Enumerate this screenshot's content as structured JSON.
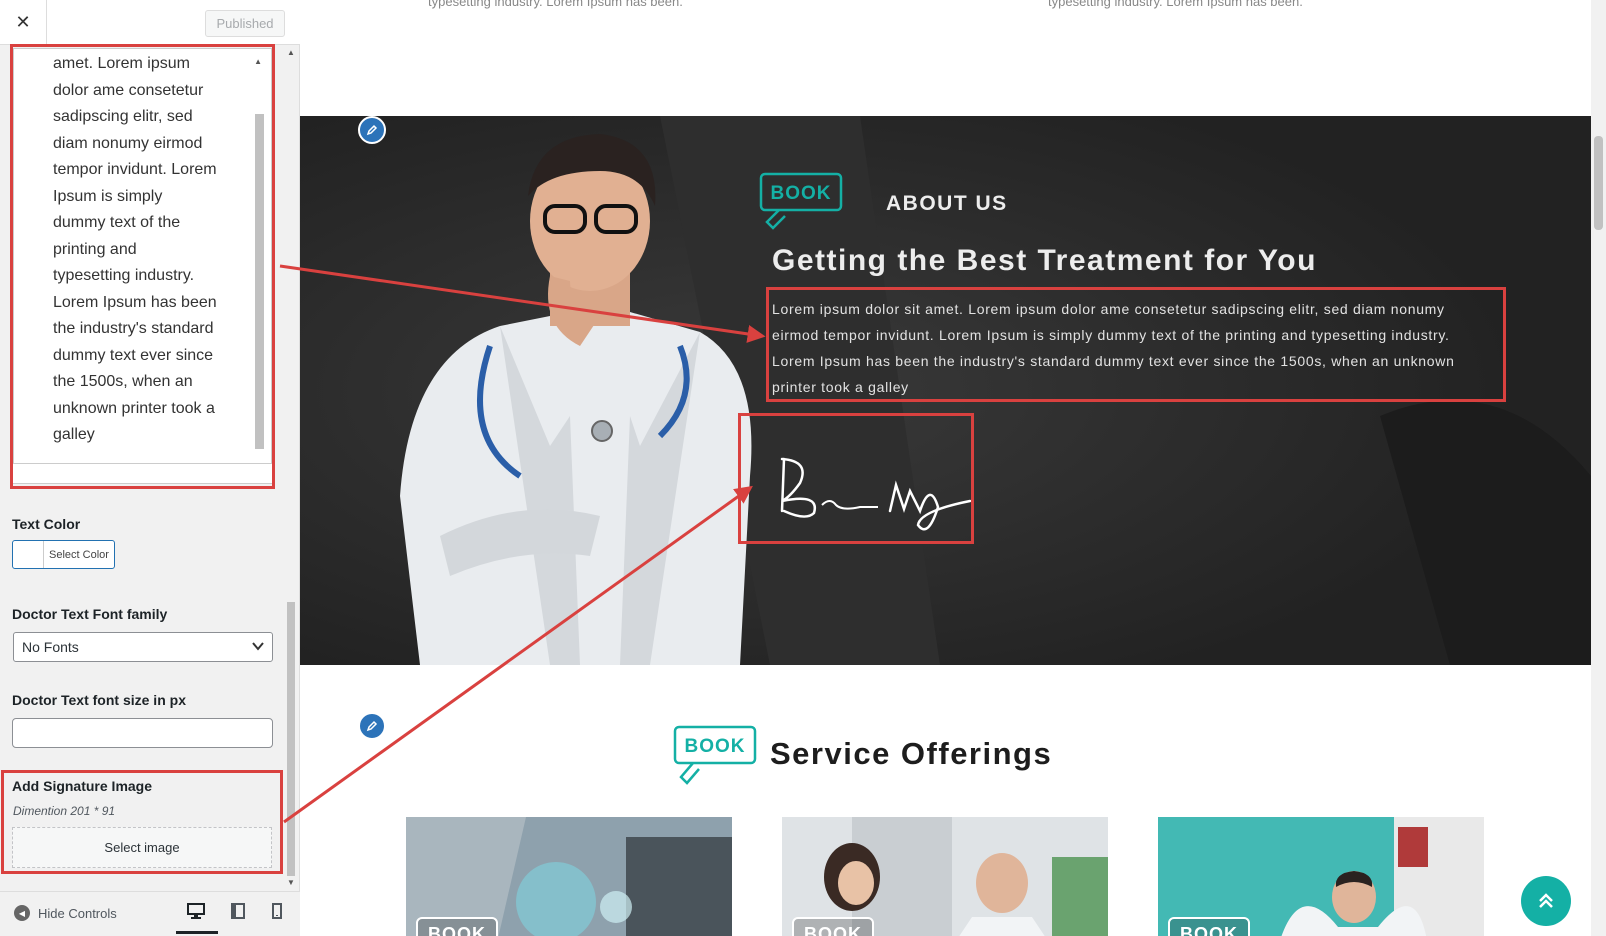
{
  "sidebar": {
    "close_icon": "close-icon",
    "published_label": "Published",
    "textarea_value": "amet. Lorem ipsum dolor ame consetetur sadipscing elitr, sed diam nonumy eirmod tempor invidunt. Lorem Ipsum is simply dummy text of the printing and typesetting industry. Lorem Ipsum has been the industry's standard dummy text ever since the 1500s, when an unknown printer took a galley",
    "text_color_label": "Text Color",
    "select_color_label": "Select Color",
    "font_family_label": "Doctor Text Font family",
    "font_family_value": "No Fonts",
    "font_size_label": "Doctor Text font size in px",
    "font_size_value": "",
    "signature_label": "Add Signature Image",
    "signature_hint": "Dimention 201 * 91",
    "select_image_label": "Select image",
    "hide_controls_label": "Hide Controls",
    "devices": [
      "desktop-icon",
      "tablet-icon",
      "mobile-icon"
    ]
  },
  "preview": {
    "top_text_left": "typesetting industry. Lorem Ipsum has been.",
    "top_text_right": "typesetting industry. Lorem Ipsum has been.",
    "about": {
      "logo_text": "BOOK",
      "subtitle": "ABOUT US",
      "title": "Getting the Best Treatment for You",
      "body": "Lorem ipsum dolor sit amet. Lorem ipsum dolor ame consetetur sadipscing elitr, sed diam nonumy eirmod tempor invidunt. Lorem Ipsum is simply dummy text of the printing and typesetting industry. Lorem Ipsum has been the industry's standard dummy text ever since the 1500s, when an unknown printer took a galley"
    },
    "services": {
      "logo_text": "BOOK",
      "title": "Service Offerings",
      "cards": [
        {
          "badge": "BOOK"
        },
        {
          "badge": "BOOK"
        },
        {
          "badge": "BOOK"
        }
      ]
    }
  },
  "colors": {
    "accent": "#14b0a5",
    "annotation": "#d9413f",
    "edit_pin": "#2c73b9"
  }
}
